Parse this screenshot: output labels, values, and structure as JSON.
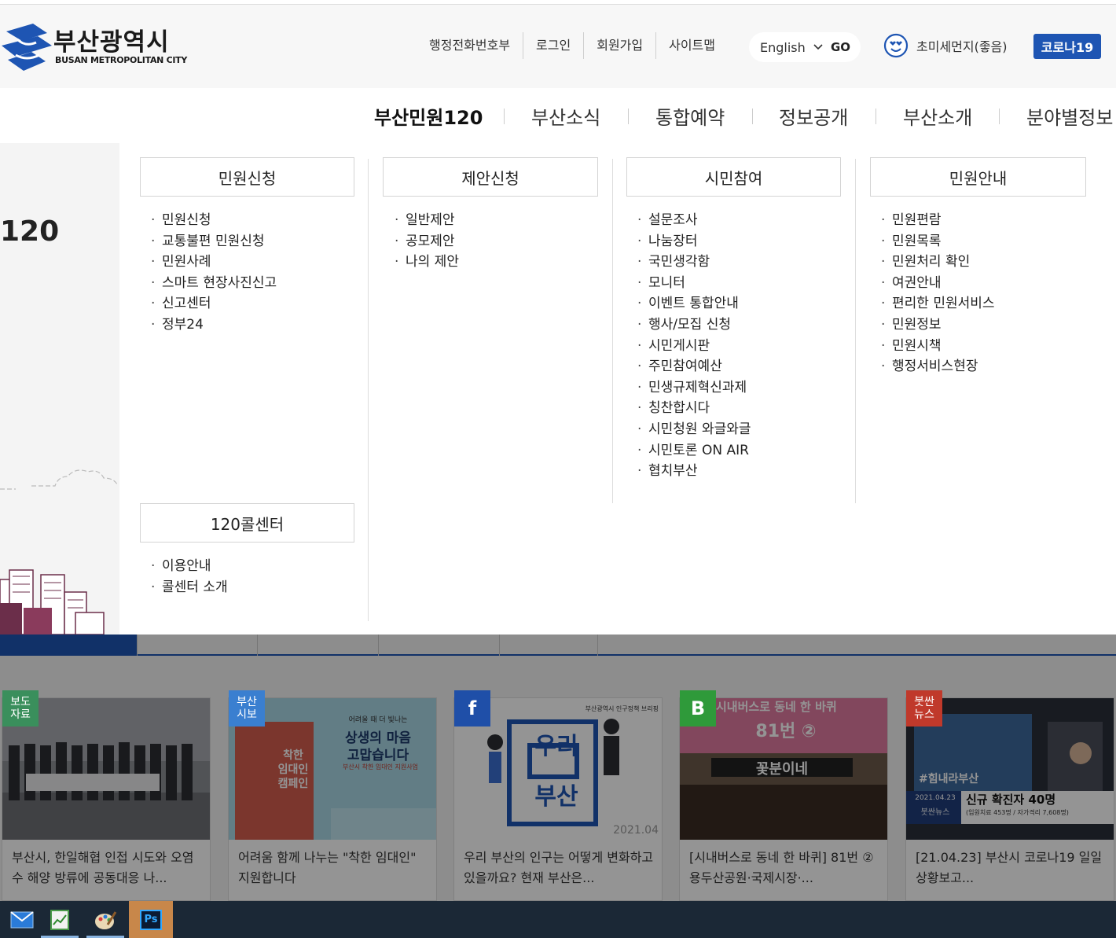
{
  "header": {
    "logo_ko": "부산광역시",
    "logo_en": "BUSAN METROPOLITAN CITY",
    "util_links": [
      "행정전화번호부",
      "로그인",
      "회원가입",
      "사이트맵"
    ],
    "language": {
      "selected": "English",
      "go_label": "GO"
    },
    "dust_status": "초미세먼지(좋음)",
    "covid_button": "코로나19"
  },
  "gnb": {
    "items": [
      "부산민원120",
      "부산소식",
      "통합예약",
      "정보공개",
      "부산소개",
      "분야별정보"
    ],
    "active_index": 0
  },
  "left_visual": {
    "title": "120"
  },
  "mega_menu": {
    "columns": [
      {
        "groups": [
          {
            "title": "민원신청",
            "items": [
              "민원신청",
              "교통불편 민원신청",
              "민원사례",
              "스마트 현장사진신고",
              "신고센터",
              "정부24"
            ]
          },
          {
            "title": "120콜센터",
            "items": [
              "이용안내",
              "콜센터 소개"
            ]
          }
        ]
      },
      {
        "groups": [
          {
            "title": "제안신청",
            "items": [
              "일반제안",
              "공모제안",
              "나의 제안"
            ]
          }
        ]
      },
      {
        "groups": [
          {
            "title": "시민참여",
            "items": [
              "설문조사",
              "나눔장터",
              "국민생각함",
              "모니터",
              "이벤트 통합안내",
              "행사/모집 신청",
              "시민게시판",
              "주민참여예산",
              "민생규제혁신과제",
              "칭찬합시다",
              "시민청원 와글와글",
              "시민토론 ON AIR",
              "협치부산"
            ]
          }
        ]
      },
      {
        "groups": [
          {
            "title": "민원안내",
            "items": [
              "민원편람",
              "민원목록",
              "민원처리 확인",
              "여권안내",
              "편리한 민원서비스",
              "민원정보",
              "민원시책",
              "행정서비스현장"
            ]
          }
        ]
      }
    ]
  },
  "news": {
    "cards": [
      {
        "badge": "보도\n자료",
        "badge_color": "#3a8f5c",
        "title": "부산시, 한일해협 인접 시도와 오염수 해양 방류에 공동대응 나..."
      },
      {
        "badge": "부산\n시보",
        "badge_color": "#3a7fd0",
        "image_text": [
          "어려울 때 더 빛나는",
          "상생의 마음",
          "고맙습니다",
          "착한",
          "임대인",
          "캠페인",
          "부산시 착한 임대인 지원사업"
        ],
        "title": "어려움 함께 나누는 \"착한 임대인\" 지원합니다"
      },
      {
        "badge": "f",
        "badge_color": "#1f4fa8",
        "image_text": [
          "부산광역시 인구정책 브리핑",
          "우리",
          "부산",
          "2021.04"
        ],
        "title": "우리 부산의 인구는 어떻게 변화하고 있을까요? 현재 부산은..."
      },
      {
        "badge": "B",
        "badge_color": "#2f9a3a",
        "image_text": [
          "시내버스로 동네 한 바퀴",
          "81번 ②",
          "꽃분이네"
        ],
        "title": "[시내버스로 동네 한 바퀴] 81번 ② 용두산공원·국제시장·..."
      },
      {
        "badge": "붓싼\n뉴스",
        "badge_color": "#c0392b",
        "image_text": [
          "#힘내라부산",
          "2021.04.23",
          "붓싼뉴스",
          "신규 확진자 40명",
          "(입원치료 453명 / 자가격리 7,608명)"
        ],
        "title": "[21.04.23] 부산시 코로나19 일일상황보고..."
      }
    ]
  },
  "taskbar": {
    "icons": [
      "mail-icon",
      "spreadsheet-icon",
      "paint-icon",
      "photoshop-icon"
    ],
    "photoshop_label": "Ps"
  },
  "colors": {
    "brand_blue": "#1e55b3",
    "covid_button": "#1e55b3",
    "taskbar": "#1b2836",
    "taskbar_active": "#c8874a"
  }
}
